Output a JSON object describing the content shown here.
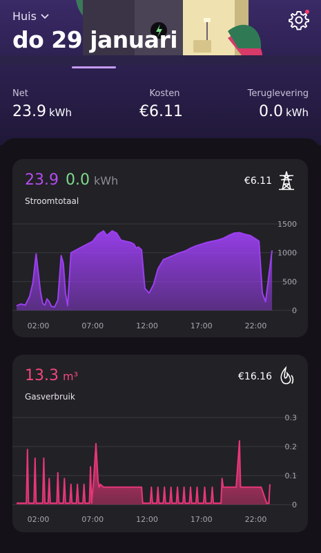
{
  "header": {
    "location": "Huis",
    "date": "do 29 januari"
  },
  "stats": [
    {
      "label": "Net",
      "value": "23.9",
      "unit": "kWh"
    },
    {
      "label": "Kosten",
      "value": "€6.11",
      "unit": ""
    },
    {
      "label": "Teruglevering",
      "value": "0.0",
      "unit": "kWh"
    }
  ],
  "electricity_card": {
    "consumption": "23.9",
    "return": "0.0",
    "unit": "kWh",
    "label": "Stroomtotaal",
    "cost": "€6.11",
    "icon": "power-pylon-icon",
    "colors": {
      "consumption": "#b44cf0",
      "return": "#7ddc8c"
    }
  },
  "gas_card": {
    "value": "13.3",
    "unit": "m³",
    "label": "Gasverbruik",
    "cost": "€16.16",
    "icon": "flame-icon",
    "color": "#f0487a"
  },
  "chart_data": [
    {
      "type": "area",
      "x_ticks": [
        "02:00",
        "07:00",
        "12:00",
        "17:00",
        "22:00"
      ],
      "y_ticks": [
        "0",
        "500",
        "1000",
        "1500"
      ],
      "ylim": [
        0,
        1500
      ],
      "xlim": [
        0,
        24
      ],
      "grid": true,
      "color": "#9b3ff0",
      "x": [
        0.0,
        0.4,
        0.8,
        1.2,
        1.5,
        1.8,
        2.0,
        2.2,
        2.4,
        2.6,
        2.8,
        3.0,
        3.2,
        3.5,
        3.8,
        4.1,
        4.3,
        4.5,
        4.7,
        5.0,
        5.5,
        6.0,
        6.5,
        7.0,
        7.5,
        8.0,
        8.3,
        8.8,
        9.2,
        9.6,
        10.0,
        10.5,
        10.8,
        11.0,
        11.2,
        11.5,
        11.8,
        12.2,
        12.6,
        13.0,
        13.5,
        14.0,
        14.5,
        15.0,
        15.5,
        16.0,
        16.5,
        17.0,
        17.5,
        18.0,
        18.5,
        19.0,
        19.5,
        20.0,
        20.5,
        21.0,
        21.5,
        22.0,
        22.3,
        22.6,
        22.9,
        23.2,
        23.5
      ],
      "y": [
        80,
        110,
        90,
        240,
        480,
        980,
        650,
        320,
        120,
        90,
        200,
        150,
        70,
        60,
        180,
        950,
        820,
        300,
        80,
        1000,
        1050,
        1100,
        1150,
        1200,
        1320,
        1380,
        1300,
        1380,
        1340,
        1220,
        1200,
        1180,
        1150,
        1080,
        1100,
        1050,
        380,
        300,
        450,
        720,
        880,
        920,
        960,
        1000,
        1030,
        1080,
        1120,
        1150,
        1180,
        1200,
        1220,
        1250,
        1300,
        1340,
        1350,
        1320,
        1300,
        1240,
        1200,
        300,
        150,
        600,
        1040
      ]
    },
    {
      "type": "area",
      "x_ticks": [
        "02:00",
        "07:00",
        "12:00",
        "17:00",
        "22:00"
      ],
      "y_ticks": [
        "0",
        "0.1",
        "0.2",
        "0.3"
      ],
      "ylim": [
        0,
        0.3
      ],
      "xlim": [
        0,
        24
      ],
      "grid": true,
      "color": "#e8367a",
      "x": [
        0.0,
        0.9,
        1.0,
        1.1,
        1.3,
        1.6,
        1.7,
        1.8,
        2.0,
        2.4,
        2.5,
        2.6,
        2.8,
        2.9,
        3.0,
        3.1,
        3.3,
        3.7,
        3.8,
        3.9,
        4.1,
        4.3,
        4.4,
        4.5,
        4.7,
        4.9,
        5.0,
        5.1,
        5.3,
        5.5,
        5.6,
        5.7,
        5.9,
        6.1,
        6.2,
        6.3,
        6.5,
        6.7,
        6.8,
        6.9,
        7.1,
        7.3,
        7.5,
        7.6,
        7.7,
        8.0,
        11.5,
        11.6,
        11.7,
        12.0,
        12.3,
        12.4,
        12.5,
        12.7,
        12.9,
        13.0,
        13.1,
        13.3,
        13.5,
        13.6,
        13.7,
        13.9,
        14.1,
        14.2,
        14.3,
        14.5,
        14.7,
        14.8,
        14.9,
        15.1,
        15.3,
        15.4,
        15.5,
        15.7,
        15.9,
        16.0,
        16.1,
        16.3,
        16.5,
        16.6,
        16.7,
        16.9,
        17.2,
        17.3,
        17.4,
        17.6,
        17.9,
        18.0,
        18.1,
        18.3,
        18.8,
        18.9,
        19.0,
        20.0,
        20.2,
        20.5,
        20.6,
        21.0,
        22.5,
        23.0,
        23.2,
        23.3
      ],
      "y": [
        0.005,
        0.005,
        0.19,
        0.005,
        0.005,
        0.005,
        0.16,
        0.005,
        0.005,
        0.005,
        0.16,
        0.005,
        0.005,
        0.005,
        0.09,
        0.005,
        0.005,
        0.005,
        0.11,
        0.005,
        0.005,
        0.005,
        0.09,
        0.005,
        0.005,
        0.005,
        0.07,
        0.005,
        0.005,
        0.005,
        0.07,
        0.005,
        0.005,
        0.005,
        0.07,
        0.005,
        0.005,
        0.005,
        0.13,
        0.005,
        0.09,
        0.21,
        0.08,
        0.06,
        0.07,
        0.06,
        0.06,
        0.005,
        0.005,
        0.005,
        0.005,
        0.06,
        0.005,
        0.005,
        0.005,
        0.06,
        0.005,
        0.005,
        0.005,
        0.06,
        0.005,
        0.005,
        0.005,
        0.06,
        0.005,
        0.005,
        0.005,
        0.06,
        0.005,
        0.005,
        0.005,
        0.06,
        0.005,
        0.005,
        0.005,
        0.06,
        0.005,
        0.005,
        0.005,
        0.06,
        0.005,
        0.005,
        0.005,
        0.06,
        0.005,
        0.005,
        0.005,
        0.06,
        0.005,
        0.005,
        0.005,
        0.09,
        0.06,
        0.06,
        0.06,
        0.22,
        0.06,
        0.06,
        0.06,
        0.005,
        0.005,
        0.07
      ]
    }
  ]
}
